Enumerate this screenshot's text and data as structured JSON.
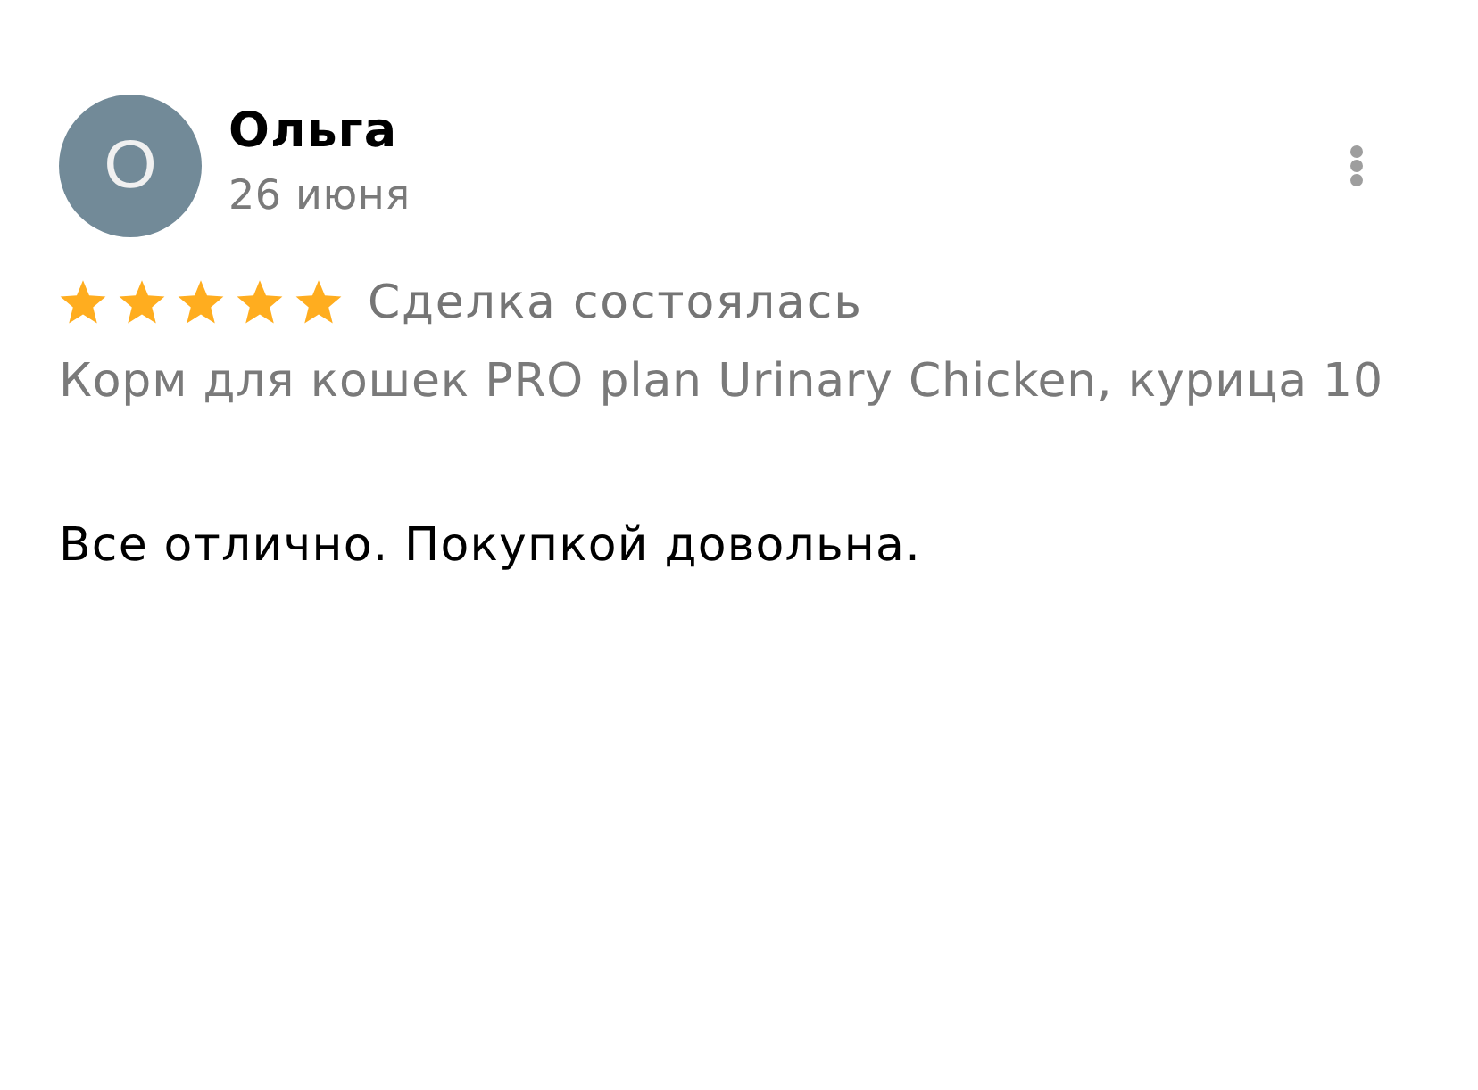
{
  "author": {
    "avatar_letter": "О",
    "name": "Ольга",
    "date": "26 июня"
  },
  "rating": {
    "stars": 5,
    "status": "Сделка состоялась"
  },
  "product": "Корм для кошек PRO plan Urinary Chicken, курица 10",
  "review_text": "Все отлично. Покупкой довольна."
}
